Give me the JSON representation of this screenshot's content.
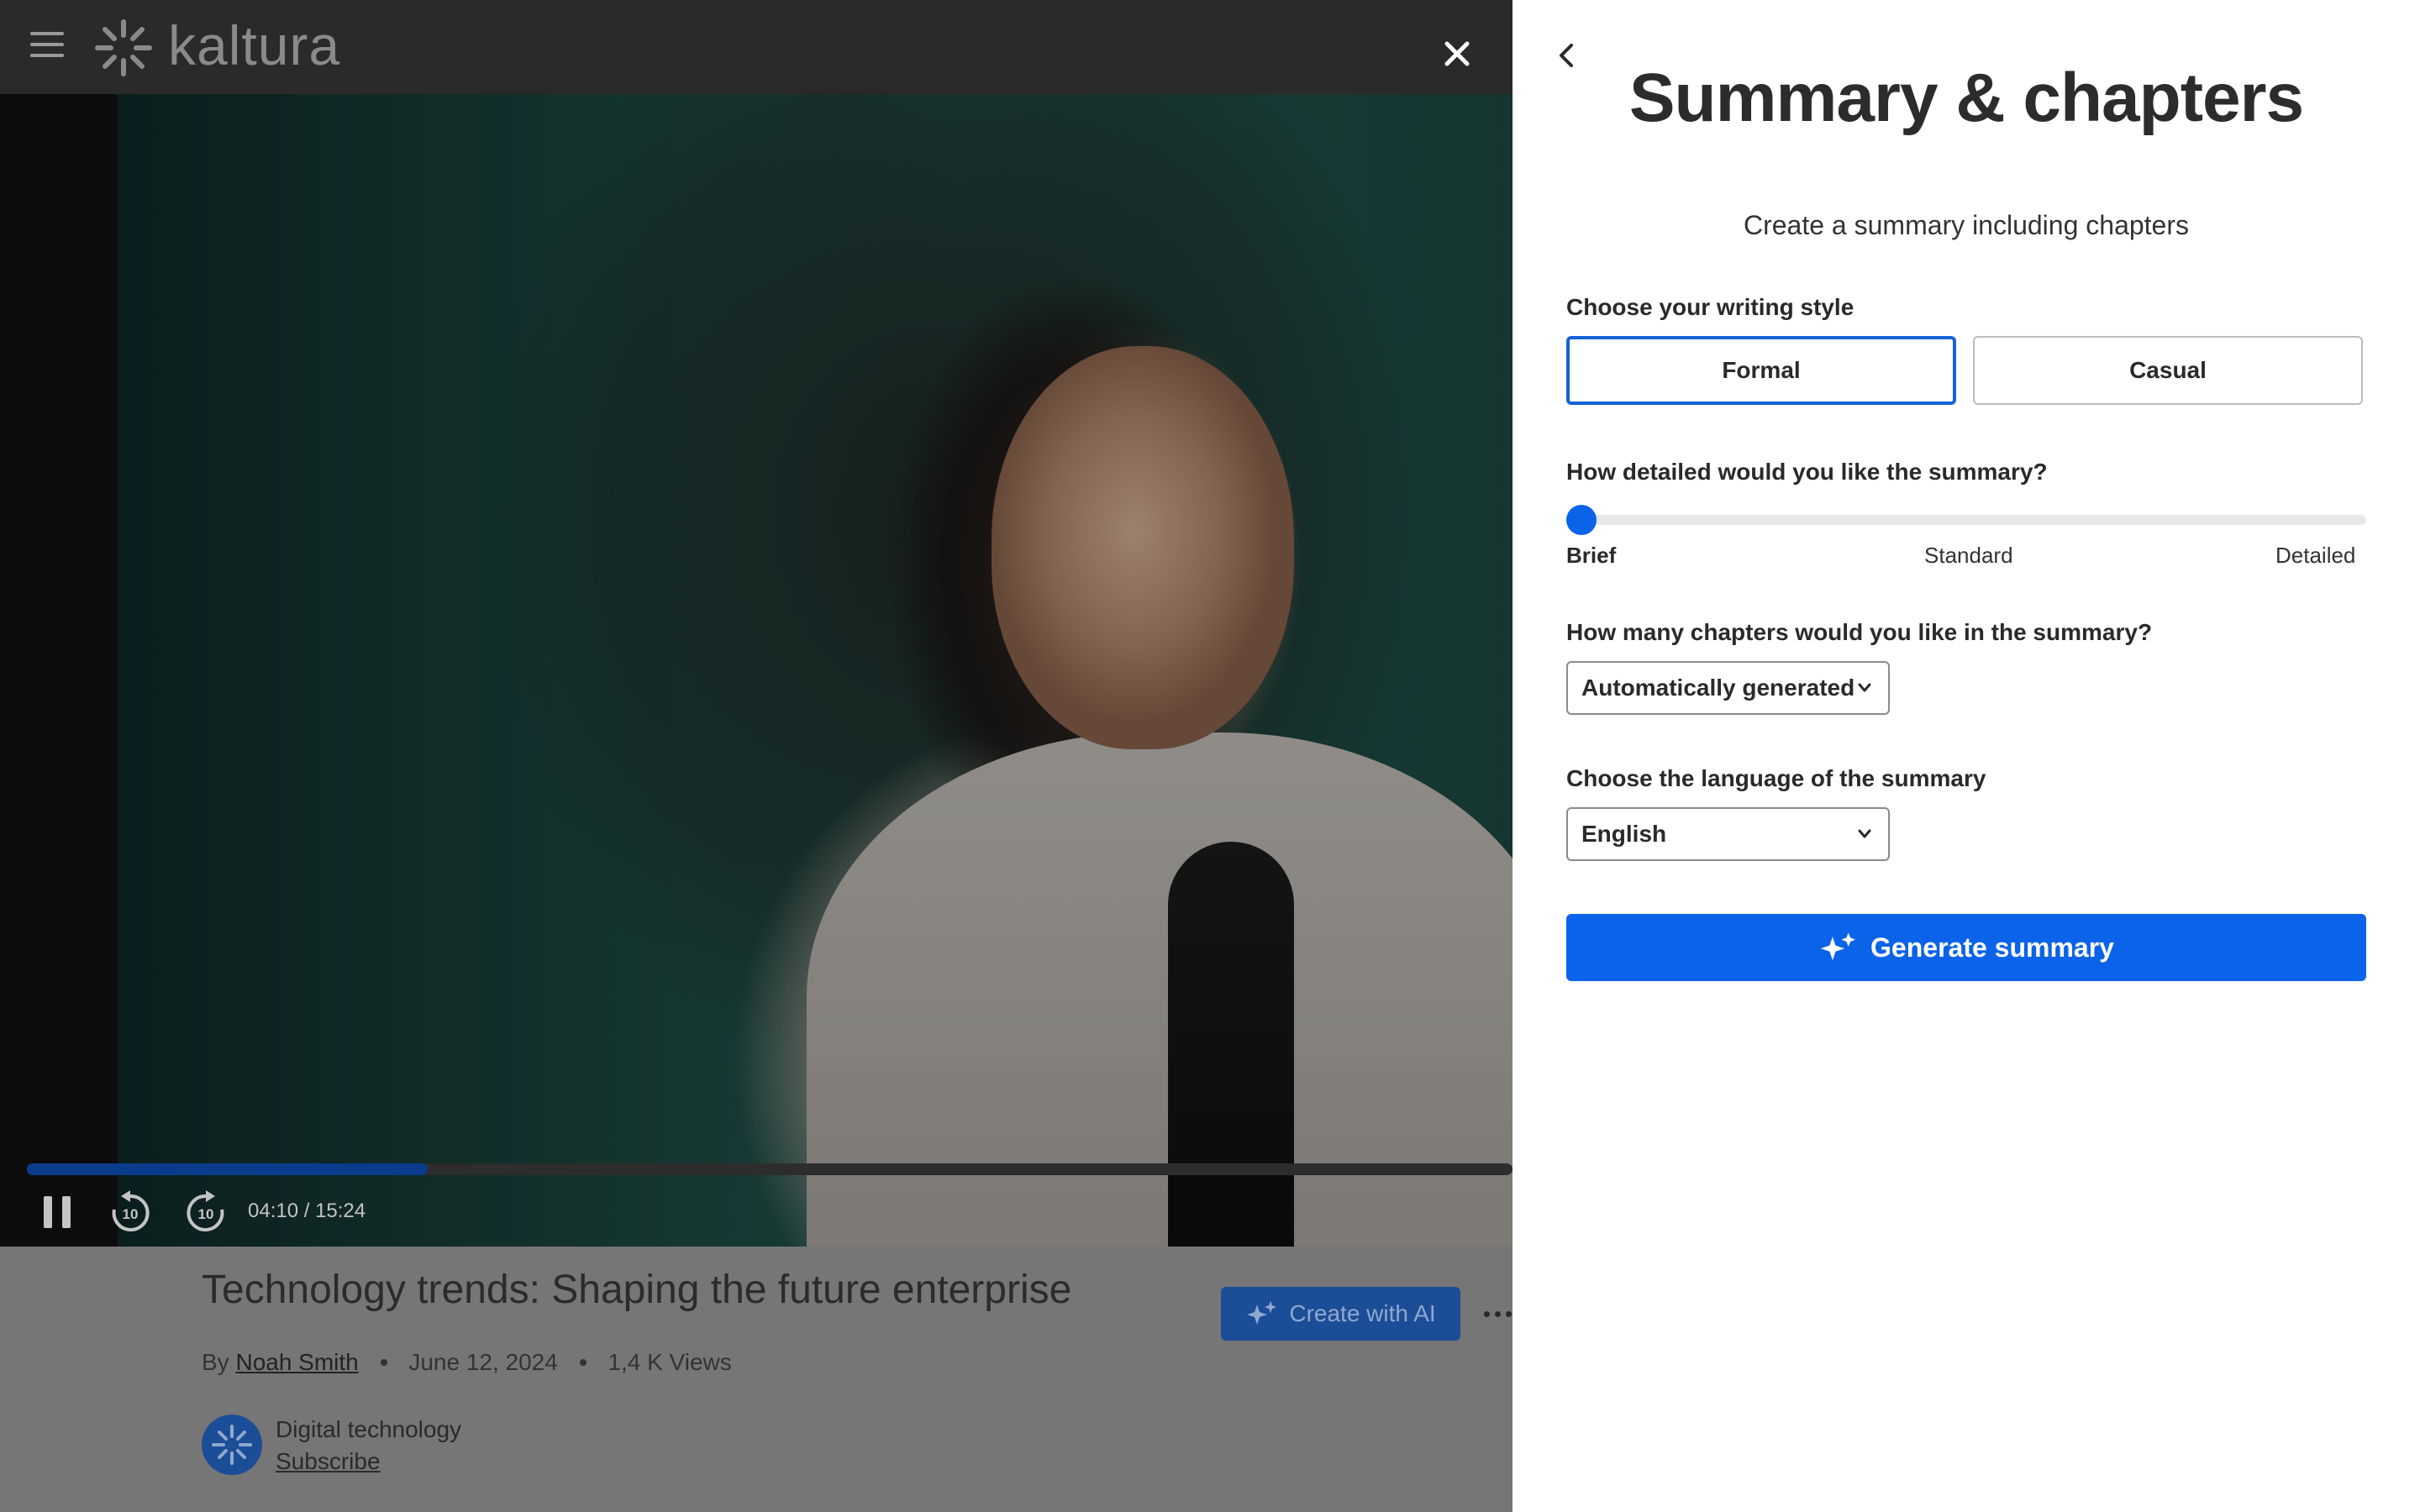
{
  "header": {
    "logo_text": "kaltura",
    "menu_icon": "hamburger-menu-icon",
    "close_icon": "close-icon"
  },
  "player": {
    "current_time": "04:10",
    "duration": "15:24",
    "time_display": "04:10 / 15:24",
    "progress_fraction": 0.27,
    "rewind_seconds": "10",
    "forward_seconds": "10"
  },
  "video": {
    "title": "Technology trends: Shaping the future enterprise",
    "by_label": "By",
    "author": "Noah Smith",
    "date": "June 12, 2024",
    "views": "1,4 K Views",
    "create_ai_label": "Create with AI"
  },
  "channel": {
    "name": "Digital technology",
    "subscribe_label": "Subscribe"
  },
  "drawer": {
    "title": "Summary & chapters",
    "subtitle": "Create a summary including chapters",
    "style_label": "Choose your writing style",
    "style_options": [
      "Formal",
      "Casual"
    ],
    "style_selected": "Formal",
    "detail_label": "How detailed would you like the summary?",
    "detail_levels": [
      "Brief",
      "Standard",
      "Detailed"
    ],
    "detail_value": "Brief",
    "detail_fraction": 0,
    "chapters_label": "How many chapters would you like in the summary?",
    "chapters_value": "Automatically generated",
    "language_label": "Choose the language of the summary",
    "language_value": "English",
    "generate_label": "Generate summary"
  },
  "colors": {
    "accent": "#0a63e8",
    "player_progress": "#0b3c8c",
    "topbar": "#2a2a2a"
  }
}
